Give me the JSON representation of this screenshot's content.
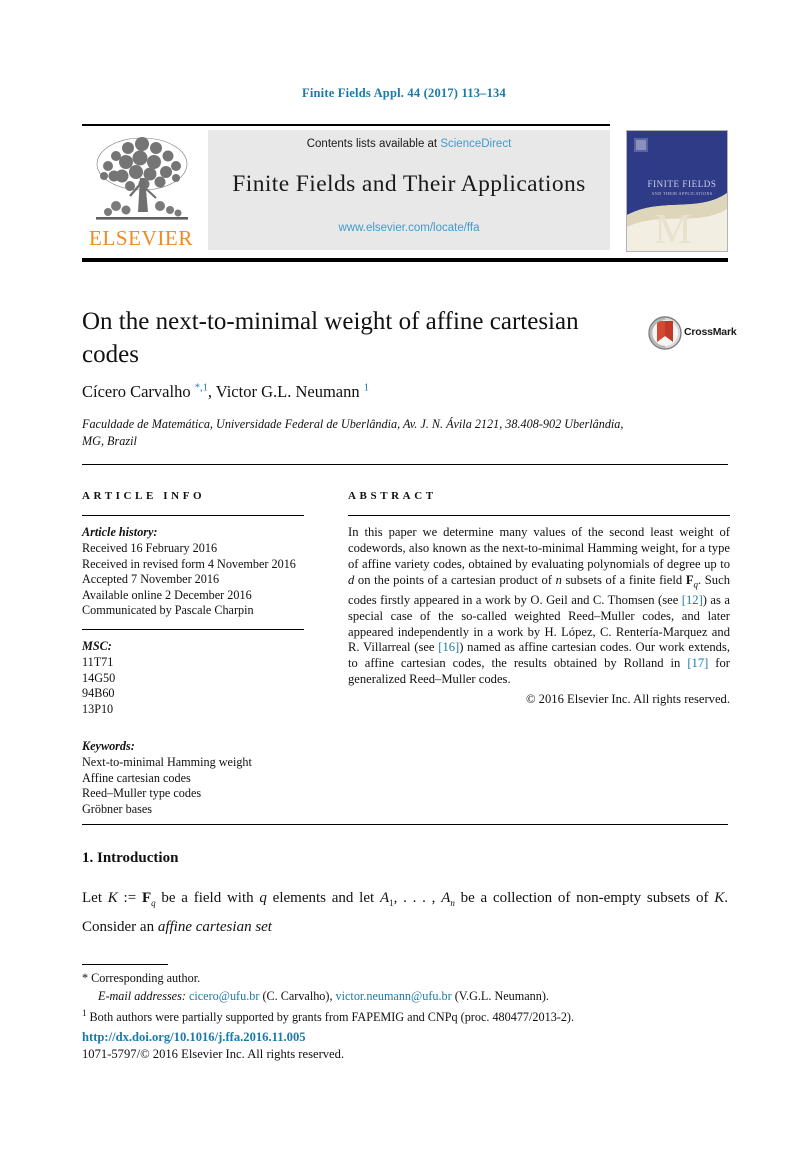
{
  "running_head": "Finite Fields Appl. 44 (2017) 113–134",
  "masthead": {
    "contents_prefix": "Contents lists available at ",
    "sciencedirect": "ScienceDirect",
    "journal_title": "Finite Fields and Their Applications",
    "journal_url": "www.elsevier.com/locate/ffa",
    "publisher_wordmark": "ELSEVIER",
    "cover_title": "FINITE FIELDS",
    "cover_subtitle": "AND THEIR APPLICATIONS"
  },
  "article": {
    "title": "On the next-to-minimal weight of affine cartesian codes",
    "crossmark_label": "CrossMark",
    "authors_html": "Cícero Carvalho <span class=\"mk\">*,1</span>, Victor G.L. Neumann <span class=\"mk\">1</span>",
    "affiliation": "Faculdade de Matemática, Universidade Federal de Uberlândia, Av. J. N. Ávila 2121, 38.408-902 Uberlândia, MG, Brazil"
  },
  "article_info": {
    "heading": "ARTICLE INFO",
    "history_label": "Article history:",
    "history": [
      "Received 16 February 2016",
      "Received in revised form 4 November 2016",
      "Accepted 7 November 2016",
      "Available online 2 December 2016",
      "Communicated by Pascale Charpin"
    ],
    "msc_label": "MSC:",
    "msc": [
      "11T71",
      "14G50",
      "94B60",
      "13P10"
    ],
    "keywords_label": "Keywords:",
    "keywords": [
      "Next-to-minimal Hamming weight",
      "Affine cartesian codes",
      "Reed–Muller type codes",
      "Gröbner bases"
    ]
  },
  "abstract": {
    "heading": "ABSTRACT",
    "body_html": "In this paper we determine many values of the second least weight of codewords, also known as the next-to-minimal Hamming weight, for a type of affine variety codes, obtained by evaluating polynomials of degree up to <i class=\"mathv\">d</i> on the points of a cartesian product of <i class=\"mathv\">n</i> subsets of a finite field <b>F</b><sub class=\"sm\"><i>q</i></sub>. Such codes firstly appeared in a work by O. Geil and C. Thomsen (see <span class=\"ref\">[12]</span>) as a special case of the so-called weighted Reed–Muller codes, and later appeared independently in a work by H. López, C. Rentería-Marquez and R. Villarreal (see <span class=\"ref\">[16]</span>) named as affine cartesian codes. Our work extends, to affine cartesian codes, the results obtained by Rolland in <span class=\"ref\">[17]</span> for generalized Reed–Muller codes.",
    "copyright": "© 2016 Elsevier Inc. All rights reserved."
  },
  "introduction": {
    "heading": "1. Introduction",
    "body_html": "Let <i class=\"mathv\">K</i> := <b>F</b><sub class=\"sm\"><i>q</i></sub> be a field with <i class=\"mathv\">q</i> elements and let <i class=\"mathv\">A</i><sub class=\"sm\">1</sub>, . . . , <i class=\"mathv\">A</i><sub class=\"sm\"><i>n</i></sub> be a collection of non-empty subsets of <i class=\"mathv\">K</i>. Consider an <span class=\"ital\">affine cartesian set</span>"
  },
  "footnotes": {
    "corresponding_marker": "*",
    "corresponding_text": "Corresponding author.",
    "email_label": "E-mail addresses:",
    "email_1": "cicero@ufu.br",
    "email_1_owner": "(C. Carvalho),",
    "email_2": "victor.neumann@ufu.br",
    "email_2_owner": "(V.G.L. Neumann).",
    "note_marker": "1",
    "note_text": "Both authors were partially supported by grants from FAPEMIG and CNPq (proc. 480477/2013-2)."
  },
  "footer": {
    "doi": "http://dx.doi.org/10.1016/j.ffa.2016.11.005",
    "issn_line": "1071-5797/© 2016 Elsevier Inc. All rights reserved."
  }
}
